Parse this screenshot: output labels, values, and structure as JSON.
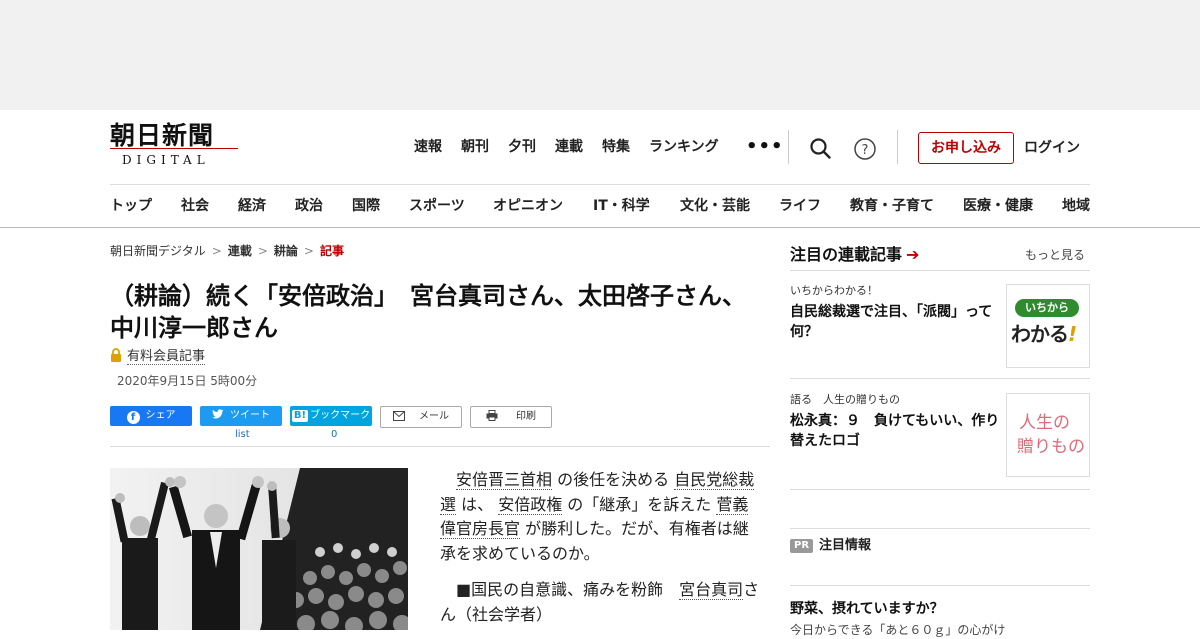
{
  "logo": {
    "kanji": "朝日新聞",
    "sub": "DIGITAL"
  },
  "topnav": [
    "速報",
    "朝刊",
    "夕刊",
    "連載",
    "特集",
    "ランキング"
  ],
  "more_dots": "•••",
  "signup_label": "お申し込み",
  "login_label": "ログイン",
  "categories": [
    "トップ",
    "社会",
    "経済",
    "政治",
    "国際",
    "スポーツ",
    "オピニオン",
    "IT・科学",
    "文化・芸能",
    "ライフ",
    "教育・子育て",
    "医療・健康",
    "地域"
  ],
  "breadcrumb": [
    "朝日新聞デジタル",
    "連載",
    "耕論",
    "記事"
  ],
  "breadcrumb_sep": ">",
  "article": {
    "title": "（耕論）続く「安倍政治」　宮台真司さん、太田啓子さん、中川淳一郎さん",
    "paid_label": "有料会員記事",
    "date": "2020年9月15日 5時00分"
  },
  "share": {
    "facebook": "シェア",
    "twitter": "ツイート",
    "hatena": "ブックマーク",
    "hatena_logo": "B!",
    "mail": "メール",
    "print": "印刷",
    "twitter_count": "list",
    "hatena_count": "0"
  },
  "body": {
    "p1_a": "安倍晋三首相",
    "p1_b": " の後任を決める ",
    "p1_c": "自民党総裁選",
    "p1_d": " は、 ",
    "p1_e": "安倍政権",
    "p1_f": " の「継承」を訴えた ",
    "p1_g": "菅義偉官房長官",
    "p1_h": " が勝利した。だが、有権者は継承を求めているのか。",
    "p2_a": "■国民の自意識、痛みを粉飾　",
    "p2_b": "宮台真司",
    "p2_c": "さん（社会学者）"
  },
  "sidebar": {
    "heading": "注目の連載記事",
    "heading_arrow": "➔",
    "more": "もっと見る",
    "cards": [
      {
        "kicker": "いちからわかる！",
        "title": "自民総裁選で注目、「派閥」って何？",
        "thumb_top": "いちから",
        "thumb_main": "わかる",
        "thumb_mark": "!"
      },
      {
        "kicker": "語る　人生の贈りもの",
        "title": "松永真：９　負けてもいい、作り替えたロゴ",
        "thumb_line1": "人生の",
        "thumb_line2": "贈りもの"
      }
    ],
    "pr_badge": "PR",
    "pr_label": "注目情報",
    "pr_title": "野菜、摂れていますか？",
    "pr_sub": "今日からできる「あと６０ｇ」の心がけ"
  },
  "colors": {
    "brand_red": "#b00000",
    "facebook": "#1877f2",
    "twitter": "#1d9bf0",
    "hatena": "#00a4de",
    "thumb_green": "#2e8b2e"
  }
}
